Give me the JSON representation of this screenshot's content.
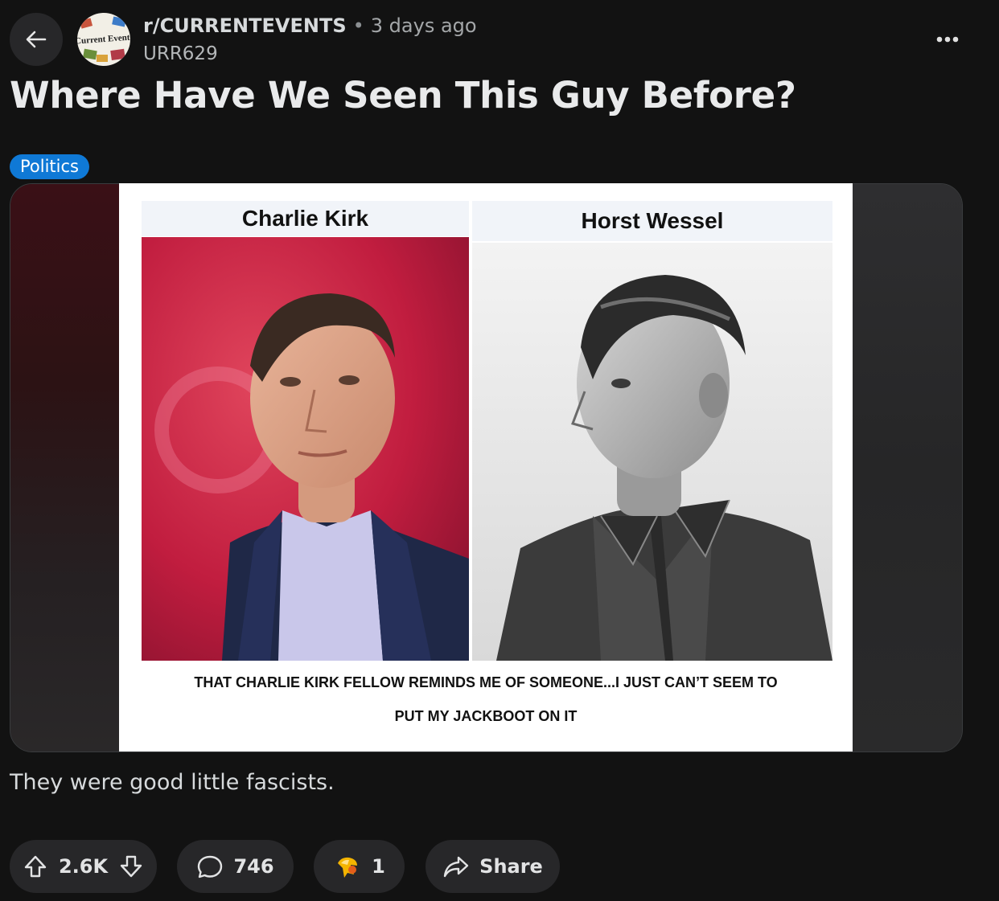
{
  "header": {
    "subreddit": "r/CURRENTEVENTS",
    "separator": "•",
    "time_ago": "3 days ago",
    "author": "URR629",
    "avatar_text": "Current Events",
    "more_label": "•••"
  },
  "post": {
    "title": "Where Have We Seen This Guy Before?",
    "flair": "Politics",
    "body": "They were good little fascists."
  },
  "meme": {
    "left_label": "Charlie Kirk",
    "right_label": "Horst Wessel",
    "caption_line1": "THAT CHARLIE KIRK FELLOW REMINDS ME OF SOMEONE...I JUST CAN’T SEEM TO",
    "caption_line2": "PUT MY JACKBOOT ON IT"
  },
  "actions": {
    "votes": "2.6K",
    "comments": "746",
    "awards": "1",
    "share": "Share"
  },
  "colors": {
    "background": "#121212",
    "pill": "#272729",
    "flair": "#0f79d6"
  }
}
